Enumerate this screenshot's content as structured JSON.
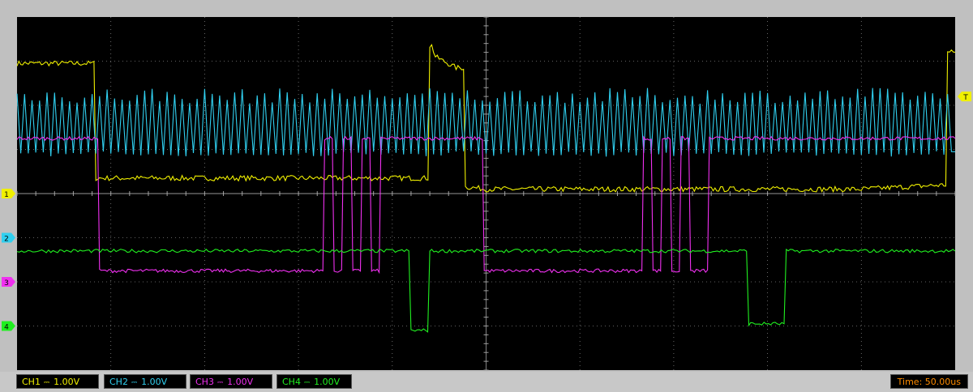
{
  "channels": [
    {
      "label": "CH1",
      "coupling": "DC",
      "scale": "1.00V",
      "color": "#f0f000",
      "marker": "1"
    },
    {
      "label": "CH2",
      "coupling": "DC",
      "scale": "1.00V",
      "color": "#30d0f0",
      "marker": "2"
    },
    {
      "label": "CH3",
      "coupling": "DC",
      "scale": "1.00V",
      "color": "#f030f0",
      "marker": "3"
    },
    {
      "label": "CH4",
      "coupling": "DC",
      "scale": "1.00V",
      "color": "#20f020",
      "marker": "4"
    }
  ],
  "timebase": {
    "label": "Time:",
    "value": "50.00us"
  },
  "trigger": {
    "marker": "T",
    "color": "#f0f000"
  },
  "chart_data": {
    "type": "line",
    "title": "",
    "xlabel": "",
    "ylabel": "",
    "grid": true,
    "x_divisions": 10,
    "y_divisions": 8,
    "x_unit": "us",
    "x_range": [
      -250,
      250
    ],
    "series": [
      {
        "name": "CH1",
        "x": [
          -250,
          -208,
          -207,
          -200,
          -100,
          -30,
          -29,
          -27,
          -16,
          -10,
          0,
          100,
          200,
          246,
          247,
          250
        ],
        "y": [
          2.95,
          2.95,
          0.35,
          0.35,
          0.35,
          0.35,
          3.35,
          3.1,
          2.85,
          0.15,
          0.1,
          0.1,
          0.1,
          0.2,
          3.2,
          3.2
        ]
      },
      {
        "name": "CH2",
        "x": [
          -250,
          -246,
          -244,
          -240,
          -238,
          -234,
          -232,
          -228,
          -226,
          -222,
          -220,
          -216,
          -214,
          -210,
          -208,
          -204,
          -202,
          -198,
          -196,
          -192,
          -190,
          -186,
          -184,
          -180,
          -178,
          -174,
          -172,
          -168
        ],
        "y": [
          2.0,
          1.0,
          2.0,
          1.0,
          2.0,
          1.0,
          2.0,
          1.0,
          2.0,
          1.0,
          2.0,
          1.0,
          2.0,
          1.0,
          2.0,
          1.0,
          2.0,
          1.0,
          2.0,
          1.0,
          2.0,
          1.0,
          2.0,
          1.0,
          2.0,
          1.0,
          2.0,
          1.0
        ]
      },
      {
        "name": "CH3",
        "x": [
          -250,
          -210,
          -205,
          -100,
          -90,
          -85,
          -80,
          -75,
          -70,
          -65,
          -60,
          -55,
          -50,
          -45,
          0,
          80,
          85,
          90,
          95,
          100,
          105,
          110,
          115,
          120,
          250
        ],
        "y": [
          1.25,
          1.25,
          -1.75,
          -1.75,
          -1.75,
          1.25,
          -1.75,
          1.25,
          -1.75,
          1.25,
          -1.75,
          1.25,
          1.25,
          1.25,
          -1.75,
          -1.75,
          1.25,
          -1.75,
          1.25,
          -1.75,
          1.25,
          -1.75,
          -1.75,
          1.25,
          1.25
        ]
      },
      {
        "name": "CH4",
        "x": [
          -250,
          -40,
          -39,
          -30,
          -29,
          -10,
          0,
          140,
          141,
          160,
          161,
          250
        ],
        "y": [
          -1.3,
          -1.3,
          -3.1,
          -3.1,
          -1.3,
          -1.3,
          -1.3,
          -1.3,
          -2.95,
          -2.95,
          -1.3,
          -1.3
        ]
      }
    ]
  }
}
